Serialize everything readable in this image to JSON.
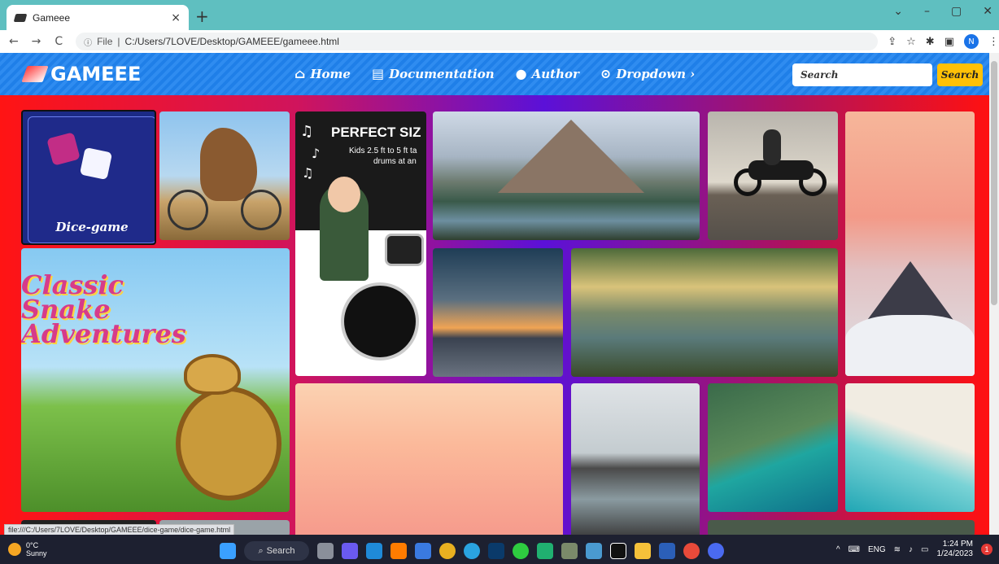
{
  "browser": {
    "tab_title": "Gameee",
    "new_tab": "+",
    "tab_close": "×",
    "back": "←",
    "forward": "→",
    "reload": "C",
    "info_icon": "ⓘ",
    "file_label": "File",
    "separator": "|",
    "url": "C:/Users/7LOVE/Desktop/GAMEEE/gameee.html",
    "profile_initial": "N",
    "status_url": "file:///C:/Users/7LOVE/Desktop/GAMEEE/dice-game/dice-game.html"
  },
  "site": {
    "logo": "GAMEEE",
    "nav": {
      "home": "Home",
      "documentation": "Documentation",
      "author": "Author",
      "dropdown": "Dropdown ›"
    },
    "search_placeholder": "Search",
    "search_button": "Search"
  },
  "gallery": {
    "dice_label": "Dice-game",
    "snake_title_line1": "Classic",
    "snake_title_line2": "Snake",
    "snake_title_line3": "Adventures",
    "drum_title": "PERFECT SIZ",
    "drum_sub_line1": "Kids 2.5 ft to 5 ft ta",
    "drum_sub_line2": "drums at an"
  },
  "taskbar": {
    "temperature": "0°C",
    "weather": "Sunny",
    "search": "Search",
    "language": "ENG",
    "time": "1:24 PM",
    "date": "1/24/2023",
    "notifications": "1"
  },
  "colors": {
    "header_blue": "#2f8cf0",
    "search_button": "#ffc107",
    "background_red": "#ff1414",
    "background_purple": "#5b11d8"
  }
}
